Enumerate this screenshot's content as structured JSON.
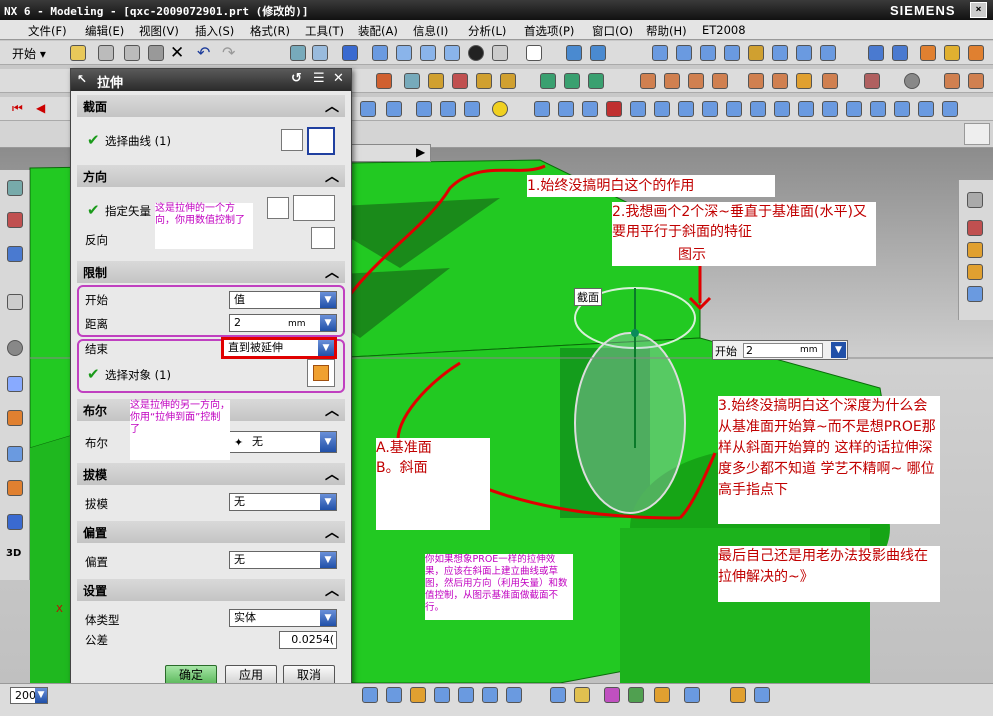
{
  "app": {
    "title": "NX 6 - Modeling - [qxc-2009072901.prt (修改的)]",
    "brand": "SIEMENS"
  },
  "menu": [
    "文件(F)",
    "编辑(E)",
    "视图(V)",
    "插入(S)",
    "格式(R)",
    "工具(T)",
    "装配(A)",
    "信息(I)",
    "分析(L)",
    "首选项(P)",
    "窗口(O)",
    "帮助(H)",
    "ET2008"
  ],
  "toolbar": {
    "start_label": "开始",
    "zoom_value": "200"
  },
  "dialog": {
    "title": "拉伸",
    "section": {
      "title": "截面",
      "select_curve": "选择曲线 (1)"
    },
    "direction": {
      "title": "方向",
      "specify_vector": "指定矢量",
      "reverse": "反向"
    },
    "limits": {
      "title": "限制",
      "start_label": "开始",
      "start_value": "值",
      "distance_label": "距离",
      "distance_value": "2",
      "distance_unit": "mm",
      "end_label": "结束",
      "end_value": "直到被延伸",
      "select_object": "选择对象 (1)"
    },
    "boolean": {
      "title": "布尔",
      "label": "布尔",
      "value": "无"
    },
    "draft": {
      "title": "拔模",
      "label": "拔模",
      "value": "无"
    },
    "offset": {
      "title": "偏置",
      "label": "偏置",
      "value": "无"
    },
    "settings": {
      "title": "设置",
      "body_type_label": "体类型",
      "body_type_value": "实体",
      "tolerance_label": "公差",
      "tolerance_value": "0.0254("
    },
    "ok": "确定",
    "apply": "应用",
    "cancel": "取消"
  },
  "viewport": {
    "section_label": "截面",
    "start_label": "开始",
    "start_value": "2",
    "start_unit": "mm",
    "axis_x": "X"
  },
  "annotations": {
    "a1": "1.始终没搞明白这个的作用",
    "a2": "2.我想画个2个深~垂直于基准面(水平)又要用平行于斜面的特征",
    "a2b": "图示",
    "a3": "3.始终没搞明白这个深度为什么会从基准面开始算~而不是想PROE那样从斜面开始算的 这样的话拉伸深度多少都不知道 学艺不精啊~ 哪位高手指点下",
    "a3b": "最后自己还是用老办法投影曲线在拉伸解决的~》",
    "ab": "A.基准面\nB。斜面",
    "m1": "这是拉伸的一个方向，你用数值控制了",
    "m2": "这是拉伸的另一方向，你用“拉伸到面”控制了",
    "m3": "你如果想象PROE一样的拉伸效果，应该在斜面上建立曲线或草图，然后用方向（利用矢量）和数值控制，从图示基准面做截面不行。"
  },
  "colors": {
    "model": "#22c922",
    "annotation_red": "#c00000",
    "annotation_magenta": "#c000c0",
    "dialog_header": "#3a3a3a"
  }
}
